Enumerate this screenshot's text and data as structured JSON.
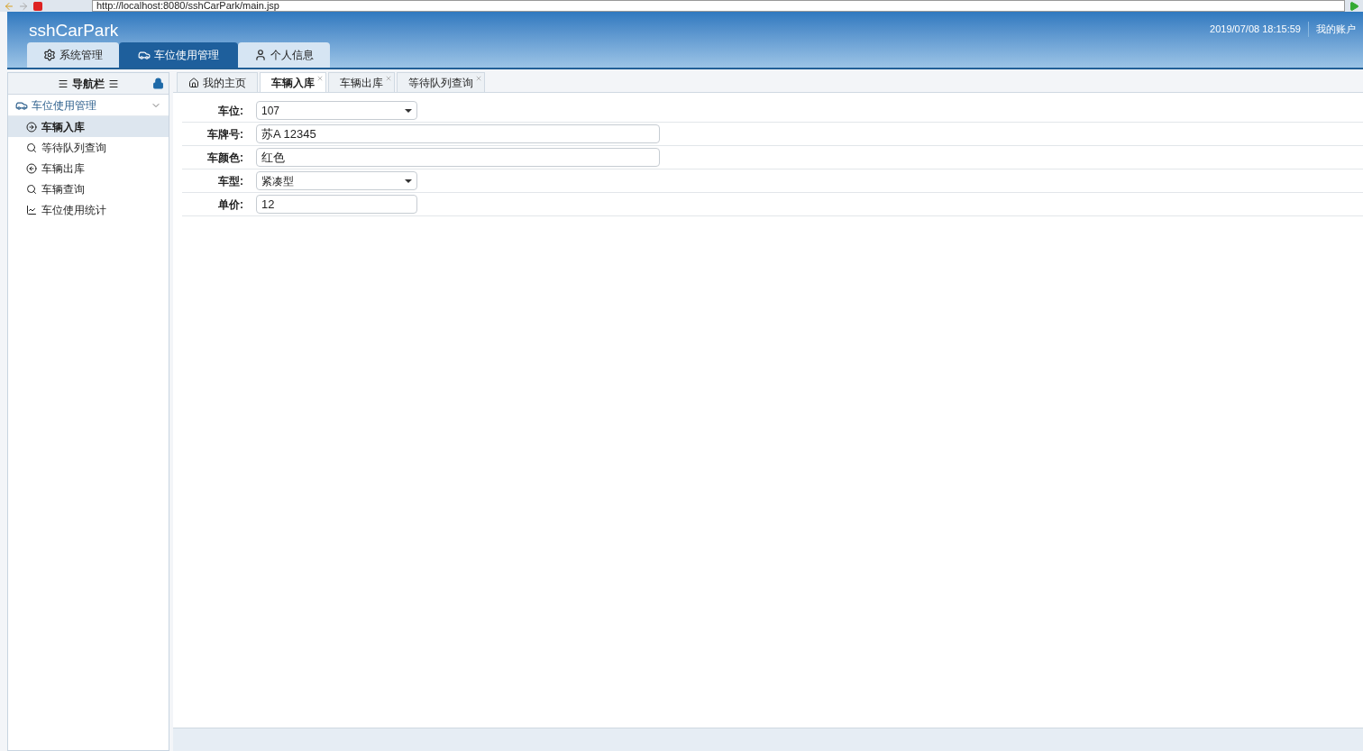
{
  "browser": {
    "url": "http://localhost:8080/sshCarPark/main.jsp"
  },
  "header": {
    "app_title": "sshCarPark",
    "datetime": "2019/07/08 18:15:59",
    "account": "我的账户"
  },
  "main_tabs": [
    {
      "label": "系统管理",
      "kind": "gear",
      "selected": false
    },
    {
      "label": "车位使用管理",
      "kind": "car",
      "selected": true
    },
    {
      "label": "个人信息",
      "kind": "user",
      "selected": false
    }
  ],
  "sidebar": {
    "title": "导航栏",
    "group": {
      "label": "车位使用管理",
      "expanded": true
    },
    "items": [
      {
        "label": "车辆入库",
        "kind": "arrow-right",
        "selected": true
      },
      {
        "label": "等待队列查询",
        "kind": "search",
        "selected": false
      },
      {
        "label": "车辆出库",
        "kind": "arrow-left",
        "selected": false
      },
      {
        "label": "车辆查询",
        "kind": "search",
        "selected": false
      },
      {
        "label": "车位使用统计",
        "kind": "chart",
        "selected": false
      }
    ]
  },
  "content_tabs": [
    {
      "label": "我的主页",
      "kind": "home",
      "closable": false,
      "selected": false
    },
    {
      "label": "车辆入库",
      "closable": true,
      "selected": true
    },
    {
      "label": "车辆出库",
      "closable": true,
      "selected": false
    },
    {
      "label": "等待队列查询",
      "closable": true,
      "selected": false
    }
  ],
  "form": {
    "fields": [
      {
        "label": "车位:",
        "kind": "select",
        "value": "107"
      },
      {
        "label": "车牌号:",
        "kind": "text",
        "value": "苏A 12345"
      },
      {
        "label": "车颜色:",
        "kind": "text",
        "value": "红色"
      },
      {
        "label": "车型:",
        "kind": "select",
        "value": "紧凑型"
      },
      {
        "label": "单价:",
        "kind": "short-text",
        "value": "12"
      }
    ]
  }
}
